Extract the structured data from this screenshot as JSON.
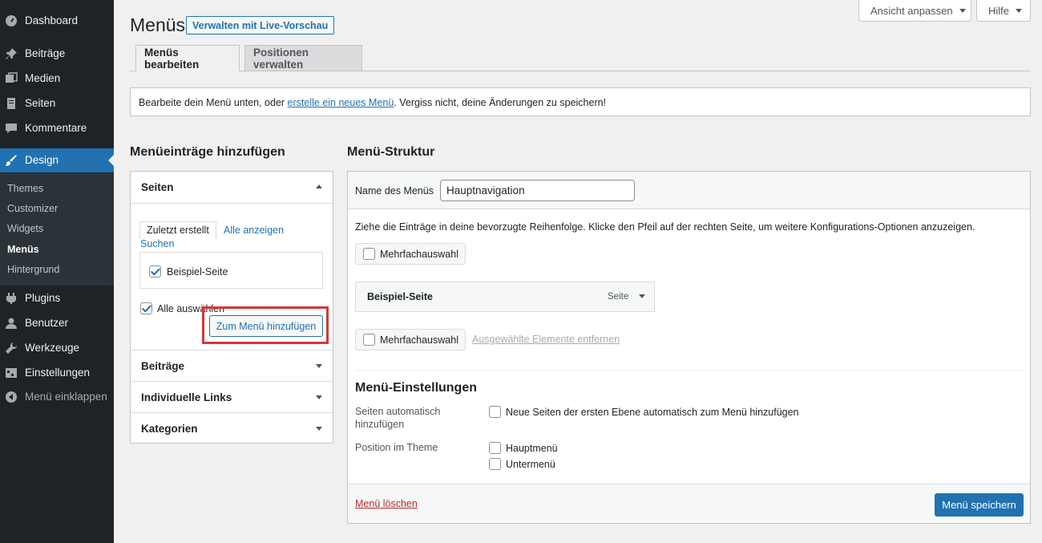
{
  "sidebar": {
    "items": [
      {
        "label": "Dashboard",
        "icon": "dashboard-icon"
      },
      {
        "label": "Beiträge",
        "icon": "pin-icon"
      },
      {
        "label": "Medien",
        "icon": "media-icon"
      },
      {
        "label": "Seiten",
        "icon": "pages-icon"
      },
      {
        "label": "Kommentare",
        "icon": "comments-icon"
      },
      {
        "label": "Design",
        "icon": "brush-icon"
      },
      {
        "label": "Plugins",
        "icon": "plugin-icon"
      },
      {
        "label": "Benutzer",
        "icon": "user-icon"
      },
      {
        "label": "Werkzeuge",
        "icon": "wrench-icon"
      },
      {
        "label": "Einstellungen",
        "icon": "settings-icon"
      },
      {
        "label": "Menü einklappen",
        "icon": "collapse-icon"
      }
    ],
    "submenu": [
      "Themes",
      "Customizer",
      "Widgets",
      "Menüs",
      "Hintergrund"
    ],
    "active": "Design",
    "current_sub": "Menüs",
    "accent": "#2271b1"
  },
  "header": {
    "screen_options": "Ansicht anpassen",
    "help": "Hilfe",
    "title": "Menüs",
    "live_preview": "Verwalten mit Live-Vorschau",
    "tabs": [
      "Menüs bearbeiten",
      "Positionen verwalten"
    ]
  },
  "notice": {
    "prefix": "Bearbeite dein Menü unten, oder ",
    "link": "erstelle ein neues Menü",
    "suffix": ". Vergiss nicht, deine Änderungen zu speichern!"
  },
  "add_items": {
    "heading": "Menüeinträge hinzufügen",
    "pages_section": {
      "title": "Seiten",
      "tabs": [
        "Zuletzt erstellt",
        "Alle anzeigen",
        "Suchen"
      ],
      "items": [
        {
          "label": "Beispiel-Seite",
          "checked": true
        }
      ],
      "select_all": "Alle auswählen",
      "select_all_checked": true,
      "add_button": "Zum Menü hinzufügen"
    },
    "sections": [
      "Beiträge",
      "Individuelle Links",
      "Kategorien"
    ],
    "highlight_color": "#d63638"
  },
  "structure": {
    "heading": "Menü-Struktur",
    "menu_name_label": "Name des Menüs",
    "menu_name_value": "Hauptnavigation",
    "instructions": "Ziehe die Einträge in deine bevorzugte Reihenfolge. Klicke den Pfeil auf der rechten Seite, um weitere Konfigurations-Optionen anzuzeigen.",
    "bulk_select": "Mehrfachauswahl",
    "menu_item": {
      "title": "Beispiel-Seite",
      "type": "Seite"
    },
    "remove_selected": "Ausgewählte Elemente entfernen",
    "settings": {
      "heading": "Menü-Einstellungen",
      "auto_add_label": "Seiten automatisch hinzufügen",
      "auto_add_option": "Neue Seiten der ersten Ebene automatisch zum Menü hinzufügen",
      "position_label": "Position im Theme",
      "positions": [
        "Hauptmenü",
        "Untermenü"
      ]
    },
    "delete": "Menü löschen",
    "save": "Menü speichern"
  }
}
